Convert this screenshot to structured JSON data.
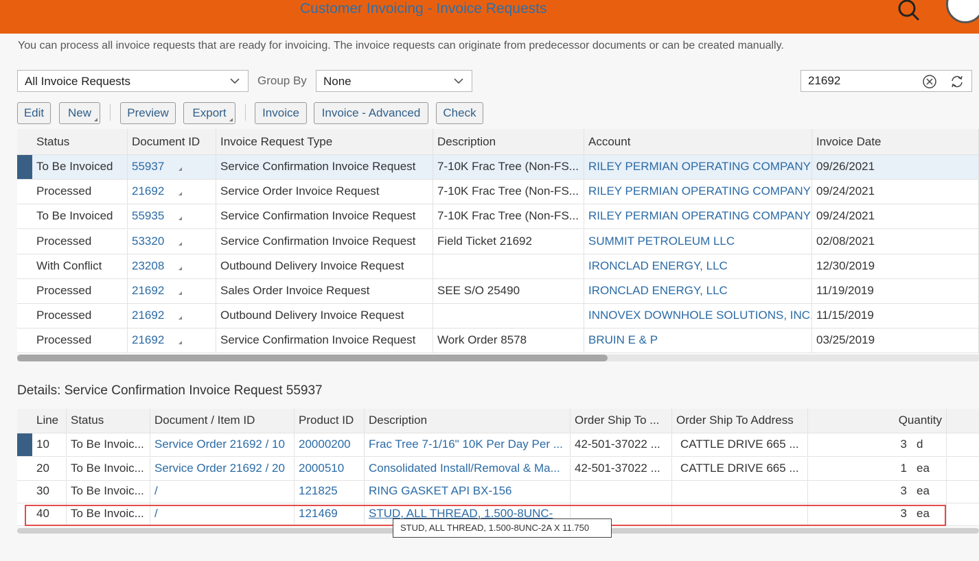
{
  "header": {
    "title": "Customer Invoicing - Invoice Requests"
  },
  "intro_text": "You can process all invoice requests that are ready for invoicing. The invoice requests can originate from predecessor documents or can be created manually.",
  "filters": {
    "view_select": "All Invoice Requests",
    "group_by_label": "Group By",
    "group_by_value": "None",
    "search_value": "21692"
  },
  "toolbar": {
    "edit": "Edit",
    "new": "New",
    "preview": "Preview",
    "export": "Export",
    "invoice": "Invoice",
    "invoice_advanced": "Invoice - Advanced",
    "check": "Check"
  },
  "main_table": {
    "columns": [
      "Status",
      "Document ID",
      "Invoice Request Type",
      "Description",
      "Account",
      "Invoice Date"
    ],
    "rows": [
      [
        "To Be Invoiced",
        "55937",
        "Service Confirmation Invoice Request",
        "7-10K Frac Tree (Non-FS...",
        "RILEY PERMIAN OPERATING COMPANY",
        "09/26/2021"
      ],
      [
        "Processed",
        "21692",
        "Service Order Invoice Request",
        "7-10K Frac Tree (Non-FS...",
        "RILEY PERMIAN OPERATING COMPANY",
        "09/24/2021"
      ],
      [
        "To Be Invoiced",
        "55935",
        "Service Confirmation Invoice Request",
        "7-10K Frac Tree (Non-FS...",
        "RILEY PERMIAN OPERATING COMPANY",
        "09/24/2021"
      ],
      [
        "Processed",
        "53320",
        "Service Confirmation Invoice Request",
        "Field Ticket 21692",
        "SUMMIT PETROLEUM LLC",
        "02/08/2021"
      ],
      [
        "With Conflict",
        "23208",
        "Outbound Delivery Invoice Request",
        "",
        "IRONCLAD ENERGY, LLC",
        "12/30/2019"
      ],
      [
        "Processed",
        "21692",
        "Sales Order Invoice Request",
        "SEE S/O 25490",
        "IRONCLAD ENERGY, LLC",
        "11/19/2019"
      ],
      [
        "Processed",
        "21692",
        "Outbound Delivery Invoice Request",
        "",
        "INNOVEX DOWNHOLE SOLUTIONS, INC.",
        "11/15/2019"
      ],
      [
        "Processed",
        "21692",
        "Service Confirmation Invoice Request",
        "Work Order 8578",
        "BRUIN E & P",
        "03/25/2019"
      ]
    ]
  },
  "details": {
    "title": "Details: Service Confirmation Invoice Request 55937",
    "columns": [
      "Line",
      "Status",
      "Document / Item ID",
      "Product ID",
      "Description",
      "Order Ship To ...",
      "Order Ship To Address",
      "Quantity"
    ],
    "rows": [
      [
        "10",
        "To Be Invoic...",
        "Service Order 21692 / 10",
        "20000200",
        "Frac Tree 7-1/16\" 10K Per Day Per ...",
        "42-501-37022 ...",
        "CATTLE DRIVE 665 ...",
        "3",
        "d"
      ],
      [
        "20",
        "To Be Invoic...",
        "Service Order 21692 / 20",
        "2000510",
        "Consolidated Install/Removal & Ma...",
        "42-501-37022 ...",
        "CATTLE DRIVE 665 ...",
        "1",
        "ea"
      ],
      [
        "30",
        "To Be Invoic...",
        "/",
        "121825",
        "RING GASKET API BX-156",
        "",
        "",
        "3",
        "ea"
      ],
      [
        "40",
        "To Be Invoic...",
        "/",
        "121469",
        "STUD, ALL THREAD, 1.500-8UNC-",
        "",
        "",
        "3",
        "ea"
      ]
    ],
    "tooltip": "STUD, ALL THREAD, 1.500-8UNC-2A X 11.750"
  }
}
